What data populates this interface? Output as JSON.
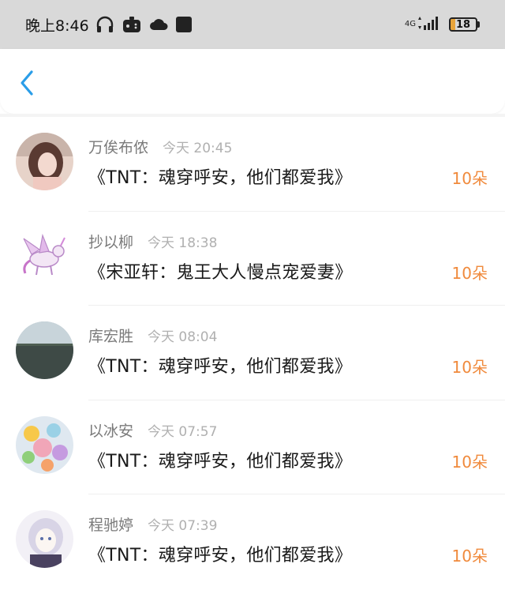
{
  "status_bar": {
    "time": "晚上8:46",
    "network": "4G",
    "battery_level": "18",
    "battery_fraction": 0.18,
    "icons": [
      "headphones-icon",
      "game-controller-icon",
      "cloud-icon",
      "app-square-icon"
    ]
  },
  "nav": {
    "back_icon": "chevron-left-icon",
    "accent_color": "#2a9de8"
  },
  "colors": {
    "gift_count": "#f08a3c",
    "name": "#7a7a7a",
    "time": "#b0b0b0"
  },
  "list": [
    {
      "name": "万俟布侬",
      "time": "今天 20:45",
      "title": "《TNT：魂穿呼安，他们都爱我》",
      "count": "10朵"
    },
    {
      "name": "抄以柳",
      "time": "今天 18:38",
      "title": "《宋亚轩：鬼王大人慢点宠爱妻》",
      "count": "10朵"
    },
    {
      "name": "库宏胜",
      "time": "今天 08:04",
      "title": "《TNT：魂穿呼安，他们都爱我》",
      "count": "10朵"
    },
    {
      "name": "以冰安",
      "time": "今天 07:57",
      "title": "《TNT：魂穿呼安，他们都爱我》",
      "count": "10朵"
    },
    {
      "name": "程驰婷",
      "time": "今天 07:39",
      "title": "《TNT：魂穿呼安，他们都爱我》",
      "count": "10朵"
    }
  ]
}
